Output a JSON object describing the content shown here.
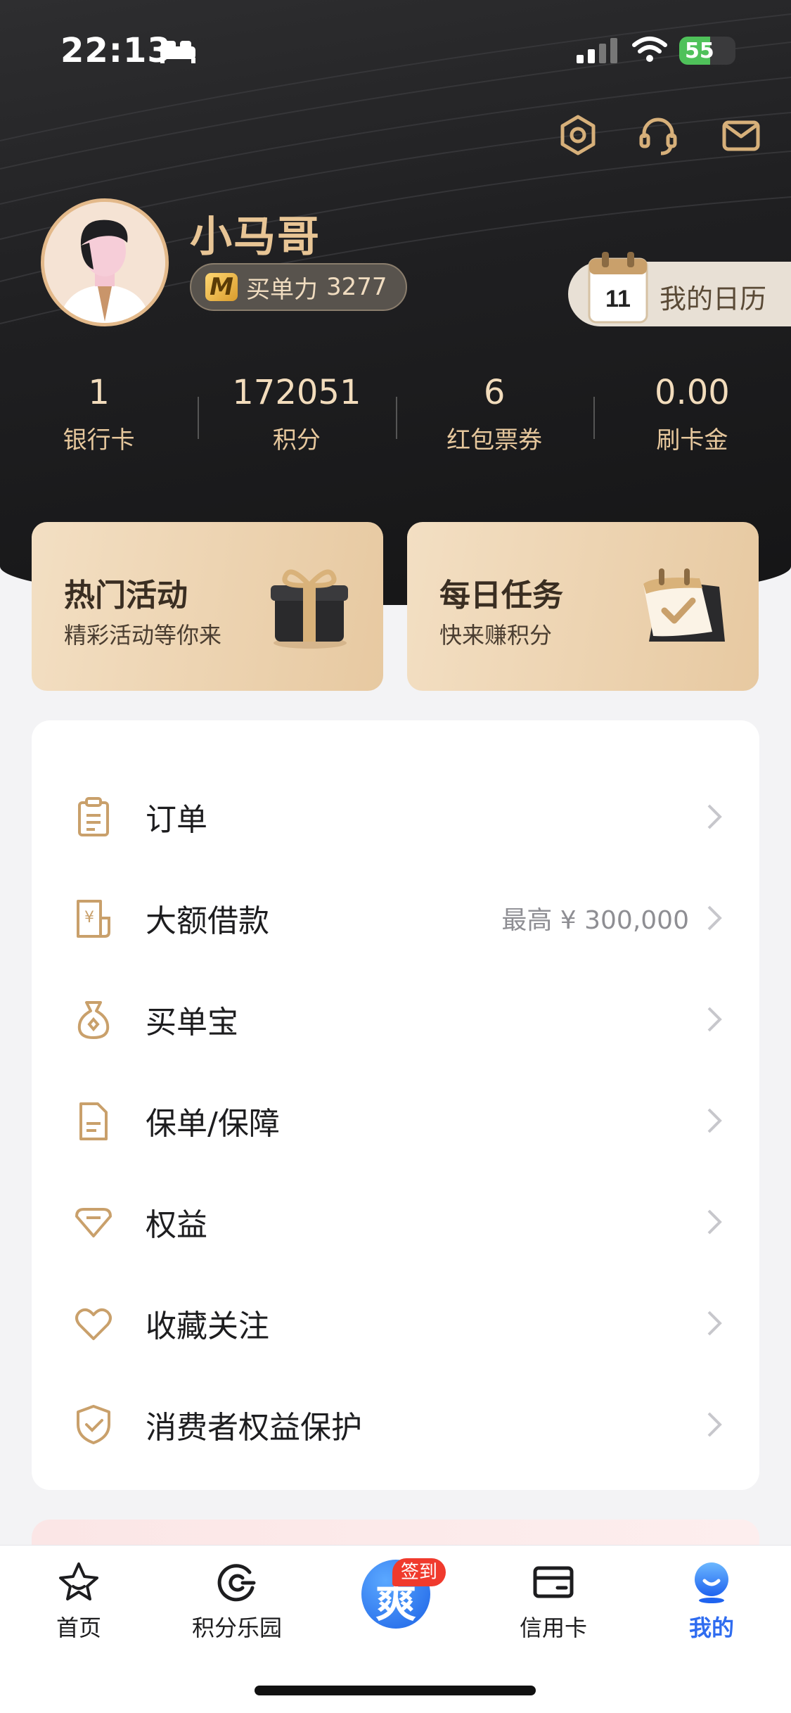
{
  "status_bar": {
    "time": "22:13",
    "battery": "55",
    "battery_level": 0.55
  },
  "profile": {
    "name": "小马哥",
    "badge_letter": "M",
    "buy_power_label": "买单力",
    "buy_power_value": "3277"
  },
  "calendar": {
    "day": "11",
    "label": "我的日历"
  },
  "stats": [
    {
      "value": "1",
      "label": "银行卡"
    },
    {
      "value": "172051",
      "label": "积分"
    },
    {
      "value": "6",
      "label": "红包票券"
    },
    {
      "value": "0.00",
      "label": "刷卡金"
    }
  ],
  "promos": [
    {
      "title": "热门活动",
      "subtitle": "精彩活动等你来"
    },
    {
      "title": "每日任务",
      "subtitle": "快来赚积分"
    }
  ],
  "menu": [
    {
      "label": "订单",
      "icon": "clipboard-icon"
    },
    {
      "label": "大额借款",
      "extra": "最高 ¥ 300,000",
      "icon": "loan-receipt-icon"
    },
    {
      "label": "买单宝",
      "icon": "money-bag-icon"
    },
    {
      "label": "保单/保障",
      "icon": "document-icon"
    },
    {
      "label": "权益",
      "icon": "benefit-tag-icon"
    },
    {
      "label": "收藏关注",
      "icon": "heart-icon"
    },
    {
      "label": "消费者权益保护",
      "icon": "shield-check-icon"
    }
  ],
  "tabs": [
    {
      "label": "首页"
    },
    {
      "label": "积分乐园"
    },
    {
      "label": "信用卡"
    },
    {
      "label": "我的"
    }
  ],
  "center_tab": {
    "glyph": "爽",
    "badge": "签到"
  },
  "colors": {
    "gold": "#e8c595",
    "accent_blue": "#2f6cf0",
    "icon_gold": "#c9a06b"
  }
}
